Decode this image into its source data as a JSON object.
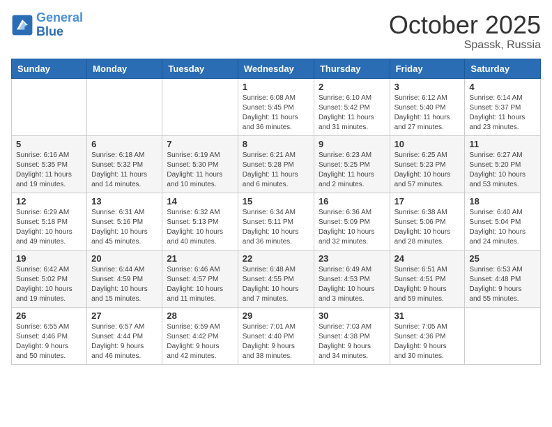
{
  "header": {
    "logo_line1": "General",
    "logo_line2": "Blue",
    "month": "October 2025",
    "location": "Spassk, Russia"
  },
  "weekdays": [
    "Sunday",
    "Monday",
    "Tuesday",
    "Wednesday",
    "Thursday",
    "Friday",
    "Saturday"
  ],
  "weeks": [
    [
      {
        "day": "",
        "info": ""
      },
      {
        "day": "",
        "info": ""
      },
      {
        "day": "",
        "info": ""
      },
      {
        "day": "1",
        "info": "Sunrise: 6:08 AM\nSunset: 5:45 PM\nDaylight: 11 hours\nand 36 minutes."
      },
      {
        "day": "2",
        "info": "Sunrise: 6:10 AM\nSunset: 5:42 PM\nDaylight: 11 hours\nand 31 minutes."
      },
      {
        "day": "3",
        "info": "Sunrise: 6:12 AM\nSunset: 5:40 PM\nDaylight: 11 hours\nand 27 minutes."
      },
      {
        "day": "4",
        "info": "Sunrise: 6:14 AM\nSunset: 5:37 PM\nDaylight: 11 hours\nand 23 minutes."
      }
    ],
    [
      {
        "day": "5",
        "info": "Sunrise: 6:16 AM\nSunset: 5:35 PM\nDaylight: 11 hours\nand 19 minutes."
      },
      {
        "day": "6",
        "info": "Sunrise: 6:18 AM\nSunset: 5:32 PM\nDaylight: 11 hours\nand 14 minutes."
      },
      {
        "day": "7",
        "info": "Sunrise: 6:19 AM\nSunset: 5:30 PM\nDaylight: 11 hours\nand 10 minutes."
      },
      {
        "day": "8",
        "info": "Sunrise: 6:21 AM\nSunset: 5:28 PM\nDaylight: 11 hours\nand 6 minutes."
      },
      {
        "day": "9",
        "info": "Sunrise: 6:23 AM\nSunset: 5:25 PM\nDaylight: 11 hours\nand 2 minutes."
      },
      {
        "day": "10",
        "info": "Sunrise: 6:25 AM\nSunset: 5:23 PM\nDaylight: 10 hours\nand 57 minutes."
      },
      {
        "day": "11",
        "info": "Sunrise: 6:27 AM\nSunset: 5:20 PM\nDaylight: 10 hours\nand 53 minutes."
      }
    ],
    [
      {
        "day": "12",
        "info": "Sunrise: 6:29 AM\nSunset: 5:18 PM\nDaylight: 10 hours\nand 49 minutes."
      },
      {
        "day": "13",
        "info": "Sunrise: 6:31 AM\nSunset: 5:16 PM\nDaylight: 10 hours\nand 45 minutes."
      },
      {
        "day": "14",
        "info": "Sunrise: 6:32 AM\nSunset: 5:13 PM\nDaylight: 10 hours\nand 40 minutes."
      },
      {
        "day": "15",
        "info": "Sunrise: 6:34 AM\nSunset: 5:11 PM\nDaylight: 10 hours\nand 36 minutes."
      },
      {
        "day": "16",
        "info": "Sunrise: 6:36 AM\nSunset: 5:09 PM\nDaylight: 10 hours\nand 32 minutes."
      },
      {
        "day": "17",
        "info": "Sunrise: 6:38 AM\nSunset: 5:06 PM\nDaylight: 10 hours\nand 28 minutes."
      },
      {
        "day": "18",
        "info": "Sunrise: 6:40 AM\nSunset: 5:04 PM\nDaylight: 10 hours\nand 24 minutes."
      }
    ],
    [
      {
        "day": "19",
        "info": "Sunrise: 6:42 AM\nSunset: 5:02 PM\nDaylight: 10 hours\nand 19 minutes."
      },
      {
        "day": "20",
        "info": "Sunrise: 6:44 AM\nSunset: 4:59 PM\nDaylight: 10 hours\nand 15 minutes."
      },
      {
        "day": "21",
        "info": "Sunrise: 6:46 AM\nSunset: 4:57 PM\nDaylight: 10 hours\nand 11 minutes."
      },
      {
        "day": "22",
        "info": "Sunrise: 6:48 AM\nSunset: 4:55 PM\nDaylight: 10 hours\nand 7 minutes."
      },
      {
        "day": "23",
        "info": "Sunrise: 6:49 AM\nSunset: 4:53 PM\nDaylight: 10 hours\nand 3 minutes."
      },
      {
        "day": "24",
        "info": "Sunrise: 6:51 AM\nSunset: 4:51 PM\nDaylight: 9 hours\nand 59 minutes."
      },
      {
        "day": "25",
        "info": "Sunrise: 6:53 AM\nSunset: 4:48 PM\nDaylight: 9 hours\nand 55 minutes."
      }
    ],
    [
      {
        "day": "26",
        "info": "Sunrise: 6:55 AM\nSunset: 4:46 PM\nDaylight: 9 hours\nand 50 minutes."
      },
      {
        "day": "27",
        "info": "Sunrise: 6:57 AM\nSunset: 4:44 PM\nDaylight: 9 hours\nand 46 minutes."
      },
      {
        "day": "28",
        "info": "Sunrise: 6:59 AM\nSunset: 4:42 PM\nDaylight: 9 hours\nand 42 minutes."
      },
      {
        "day": "29",
        "info": "Sunrise: 7:01 AM\nSunset: 4:40 PM\nDaylight: 9 hours\nand 38 minutes."
      },
      {
        "day": "30",
        "info": "Sunrise: 7:03 AM\nSunset: 4:38 PM\nDaylight: 9 hours\nand 34 minutes."
      },
      {
        "day": "31",
        "info": "Sunrise: 7:05 AM\nSunset: 4:36 PM\nDaylight: 9 hours\nand 30 minutes."
      },
      {
        "day": "",
        "info": ""
      }
    ]
  ]
}
